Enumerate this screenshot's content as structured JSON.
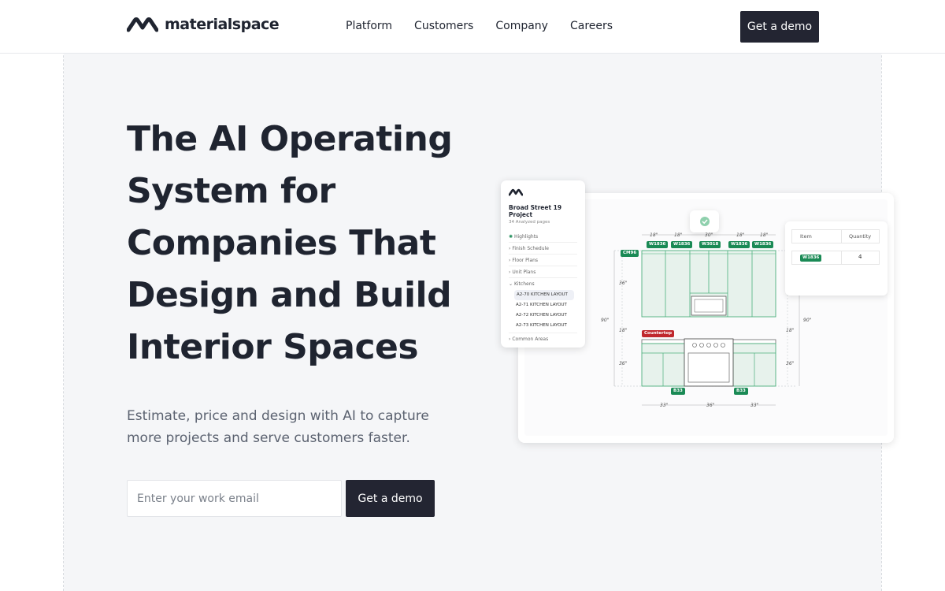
{
  "header": {
    "logo_text": "materialspace",
    "nav": [
      "Platform",
      "Customers",
      "Company",
      "Careers"
    ],
    "demo_label": "Get a demo"
  },
  "hero": {
    "headline": "The AI Operating System for Companies That Design and Build Interior Spaces",
    "subtext": "Estimate, price and design with AI to capture more projects and serve customers faster.",
    "email_placeholder": "Enter your work email",
    "cta_label": "Get a demo"
  },
  "mockup": {
    "project_title": "Broad Street 19 Project",
    "project_sub": "34 Analyzed pages",
    "sections": [
      "Highlights",
      "Finish Schedule",
      "Floor Plans",
      "Unit Plans",
      "Kitchens"
    ],
    "kitchen_items": [
      "A2-70 KITCHEN LAYOUT",
      "A2-71 KITCHEN LAYOUT",
      "A2-72 KITCHEN LAYOUT",
      "A2-73 KITCHEN LAYOUT"
    ],
    "last_section": "Common Areas",
    "table": {
      "col_item": "Item",
      "col_qty": "Quantity",
      "row_item": "W1836",
      "row_qty": "4"
    },
    "upper_tags": [
      "W1836",
      "W1836",
      "W3018",
      "W1836",
      "W1836"
    ],
    "upper_dims": [
      "18\"",
      "18\"",
      "30\"",
      "18\"",
      "18\""
    ],
    "cm_tag": "CM96",
    "countertop_tag": "Countertop",
    "lower_tags": [
      "B33",
      "B33"
    ],
    "lower_dims": [
      "33\"",
      "36\"",
      "33\""
    ],
    "side_dims": [
      "36\"",
      "90\"",
      "18\"",
      "36\"",
      "18\"",
      "90\"",
      "36\""
    ],
    "accent_green": "#1a8a55",
    "accent_red": "#c0282d"
  }
}
